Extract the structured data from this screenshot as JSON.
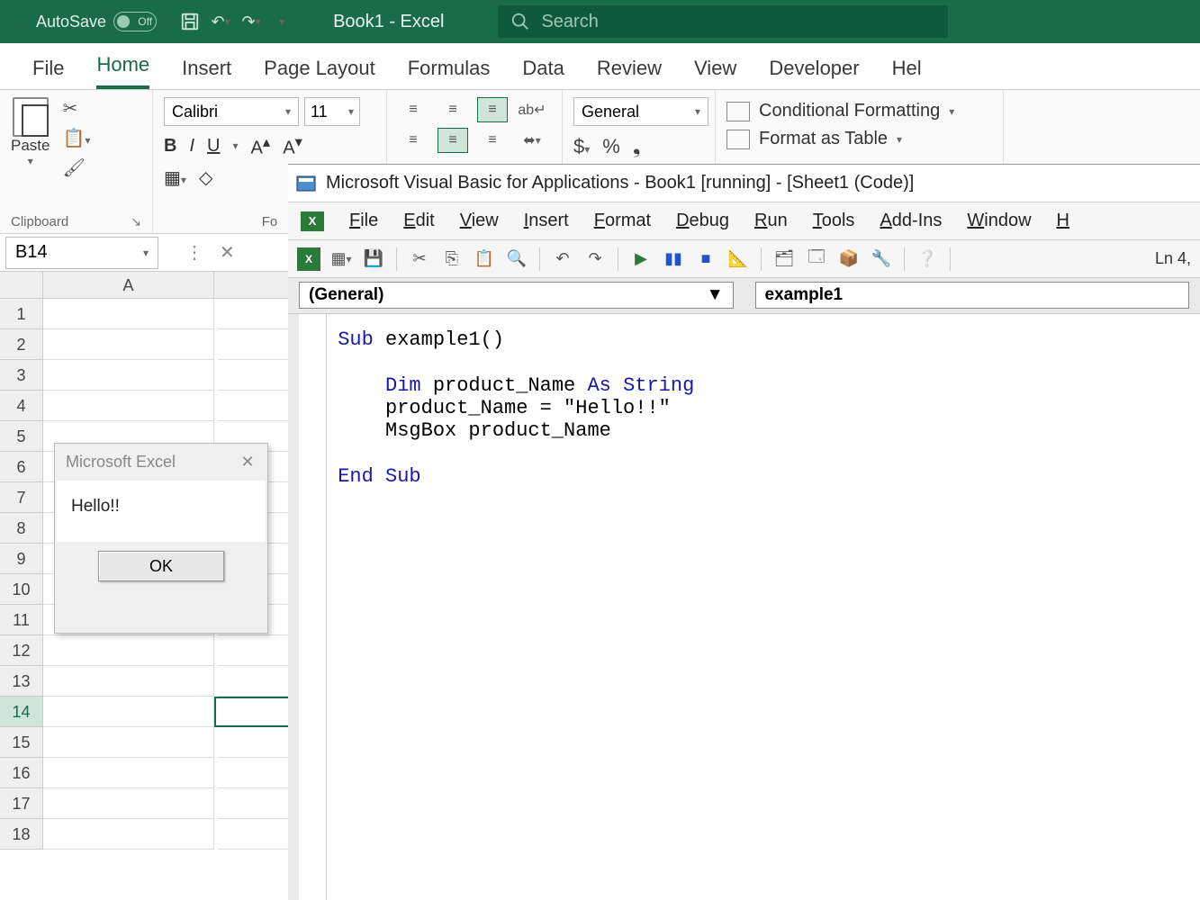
{
  "titlebar": {
    "autosave_label": "AutoSave",
    "autosave_state": "Off",
    "doc_title": "Book1 - Excel",
    "search_placeholder": "Search"
  },
  "ribbon_tabs": [
    "File",
    "Home",
    "Insert",
    "Page Layout",
    "Formulas",
    "Data",
    "Review",
    "View",
    "Developer",
    "Hel"
  ],
  "ribbon_active": "Home",
  "clipboard": {
    "paste_label": "Paste",
    "group_label": "Clipboard"
  },
  "font": {
    "name": "Calibri",
    "size": "11",
    "group_label": "Fo"
  },
  "number": {
    "format": "General"
  },
  "styles": {
    "conditional": "Conditional Formatting",
    "table": "Format as Table"
  },
  "namebox": "B14",
  "columns": [
    "A"
  ],
  "rows": [
    "1",
    "2",
    "3",
    "4",
    "5",
    "6",
    "7",
    "8",
    "9",
    "10",
    "11",
    "12",
    "13",
    "14",
    "15",
    "16",
    "17",
    "18"
  ],
  "selected_row": "14",
  "msgbox": {
    "title": "Microsoft Excel",
    "message": "Hello!!",
    "ok": "OK"
  },
  "vba": {
    "title": "Microsoft Visual Basic for Applications - Book1 [running] - [Sheet1 (Code)]",
    "menu": [
      "File",
      "Edit",
      "View",
      "Insert",
      "Format",
      "Debug",
      "Run",
      "Tools",
      "Add-Ins",
      "Window",
      "H"
    ],
    "line_col": "Ln 4,",
    "dd_left": "(General)",
    "dd_right": "example1",
    "code_lines": [
      {
        "indent": 0,
        "tokens": [
          {
            "t": "Sub ",
            "kw": true
          },
          {
            "t": "example1()"
          }
        ]
      },
      {
        "indent": 0,
        "tokens": [
          {
            "t": ""
          }
        ]
      },
      {
        "indent": 1,
        "tokens": [
          {
            "t": "Dim ",
            "kw": true
          },
          {
            "t": "product_Name "
          },
          {
            "t": "As String",
            "kw": true
          }
        ]
      },
      {
        "indent": 1,
        "tokens": [
          {
            "t": "product_Name = \"Hello!!\""
          }
        ]
      },
      {
        "indent": 1,
        "tokens": [
          {
            "t": "MsgBox product_Name"
          }
        ]
      },
      {
        "indent": 0,
        "tokens": [
          {
            "t": ""
          }
        ]
      },
      {
        "indent": 0,
        "tokens": [
          {
            "t": "End Sub",
            "kw": true
          }
        ]
      }
    ]
  }
}
